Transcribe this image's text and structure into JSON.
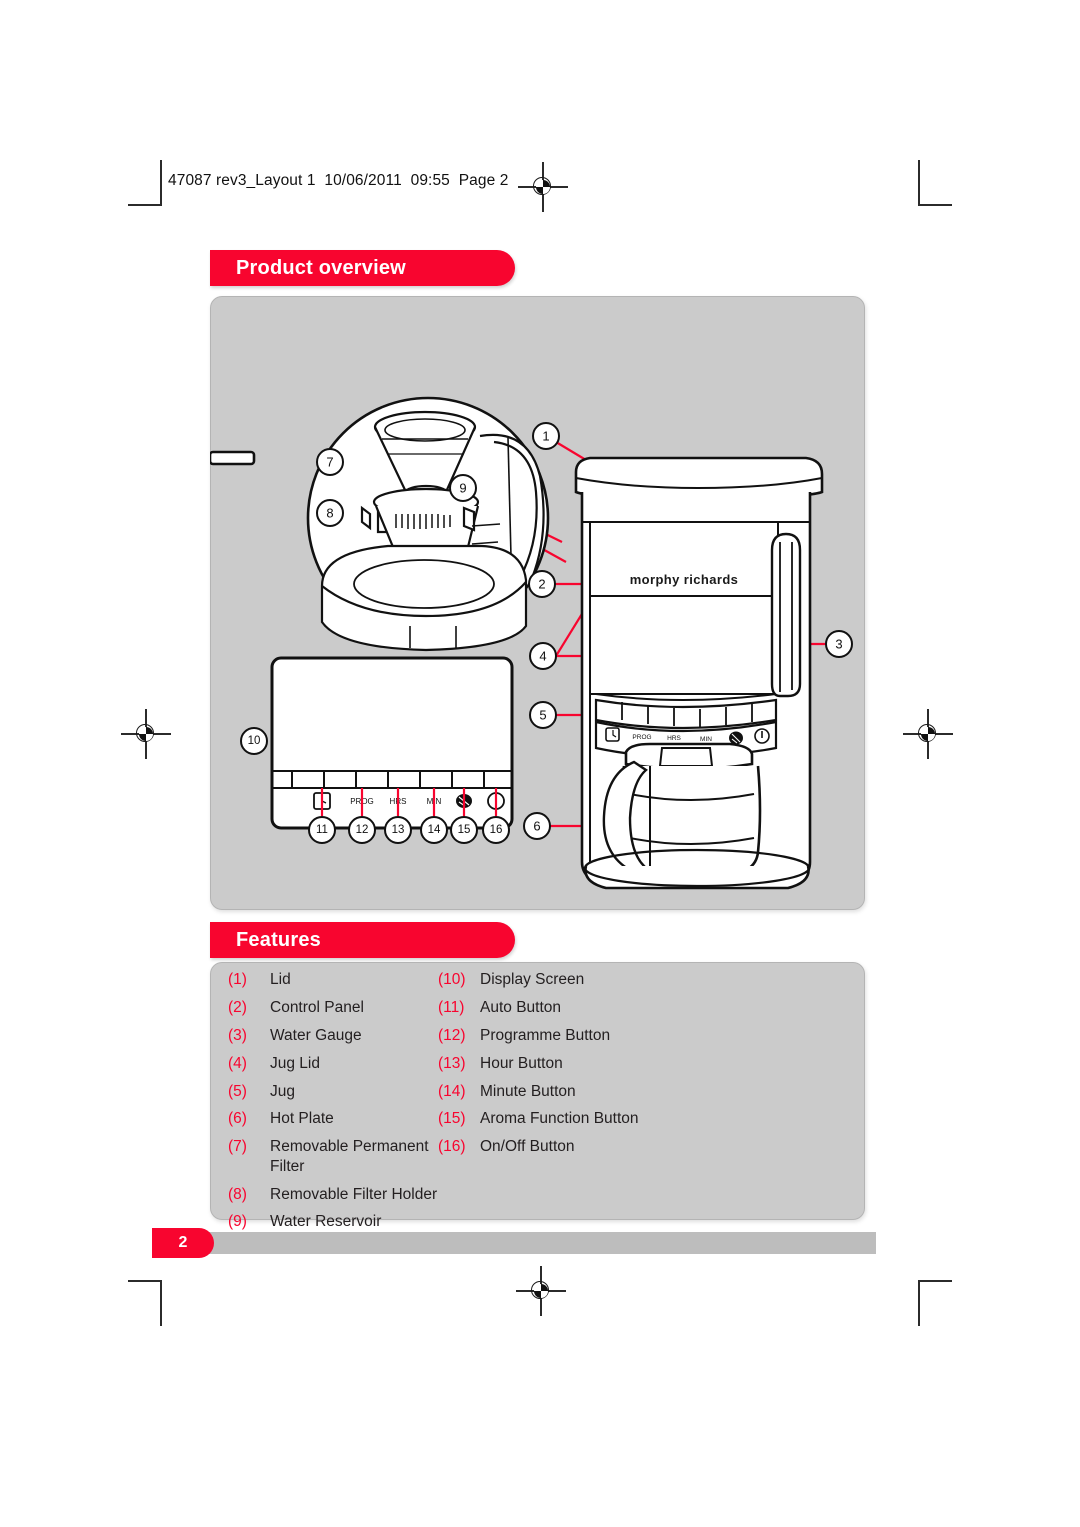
{
  "page": {
    "header_text": "47087 rev3_Layout 1  10/06/2011  09:55  Page 2",
    "page_number": "2",
    "accent_color": "#f8052f",
    "panel_color": "#cbcbcb"
  },
  "sections": {
    "product_overview": {
      "title": "Product overview"
    },
    "features": {
      "title": "Features"
    }
  },
  "features": {
    "left_column": [
      {
        "num": "(1)",
        "label": "Lid"
      },
      {
        "num": "(2)",
        "label": "Control Panel"
      },
      {
        "num": "(3)",
        "label": "Water Gauge"
      },
      {
        "num": "(4)",
        "label": "Jug Lid"
      },
      {
        "num": "(5)",
        "label": "Jug"
      },
      {
        "num": "(6)",
        "label": "Hot Plate"
      },
      {
        "num": "(7)",
        "label": "Removable Permanent Filter"
      },
      {
        "num": "(8)",
        "label": "Removable Filter Holder"
      },
      {
        "num": "(9)",
        "label": "Water Reservoir"
      }
    ],
    "right_column": [
      {
        "num": "(10)",
        "label": "Display Screen"
      },
      {
        "num": "(11)",
        "label": "Auto Button"
      },
      {
        "num": "(12)",
        "label": "Programme Button"
      },
      {
        "num": "(13)",
        "label": "Hour Button"
      },
      {
        "num": "(14)",
        "label": "Minute Button"
      },
      {
        "num": "(15)",
        "label": "Aroma Function Button"
      },
      {
        "num": "(16)",
        "label": "On/Off Button"
      }
    ]
  },
  "illustration": {
    "brand_logo": "morphy richards",
    "callouts": {
      "c1": "1",
      "c2": "2",
      "c3": "3",
      "c4": "4",
      "c5": "5",
      "c6": "6",
      "c7": "7",
      "c8": "8",
      "c9": "9",
      "c10": "10",
      "c11": "11",
      "c12": "12",
      "c13": "13",
      "c14": "14",
      "c15": "15",
      "c16": "16"
    },
    "control_panel_labels": {
      "prog": "PROG",
      "hrs": "HRS",
      "min": "MIN"
    }
  }
}
